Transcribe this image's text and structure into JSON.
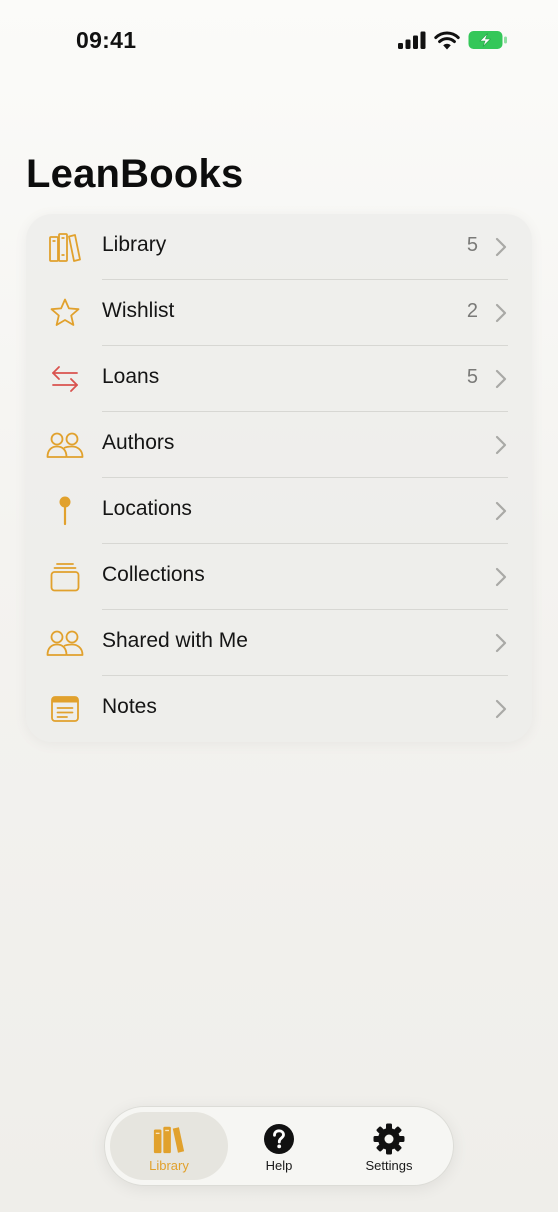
{
  "status_bar": {
    "time": "09:41",
    "icons": [
      "cellular-signal-icon",
      "wifi-icon",
      "battery-charging-icon"
    ]
  },
  "title": "LeanBooks",
  "colors": {
    "accent": "#e1a12d",
    "loans_red": "#d9534f",
    "battery_green": "#34c759",
    "text_primary": "#151515",
    "text_secondary": "#7a7a78"
  },
  "menu": {
    "items": [
      {
        "label": "Library",
        "count": "5",
        "icon": "bookshelf-icon"
      },
      {
        "label": "Wishlist",
        "count": "2",
        "icon": "star-icon"
      },
      {
        "label": "Loans",
        "count": "5",
        "icon": "arrows-exchange-icon"
      },
      {
        "label": "Authors",
        "count": "",
        "icon": "people-icon"
      },
      {
        "label": "Locations",
        "count": "",
        "icon": "pin-icon"
      },
      {
        "label": "Collections",
        "count": "",
        "icon": "stack-icon"
      },
      {
        "label": "Shared with Me",
        "count": "",
        "icon": "people-icon"
      },
      {
        "label": "Notes",
        "count": "",
        "icon": "notes-icon"
      }
    ]
  },
  "tabs": [
    {
      "label": "Library",
      "icon": "books-icon",
      "active": true
    },
    {
      "label": "Help",
      "icon": "question-circle-icon",
      "active": false
    },
    {
      "label": "Settings",
      "icon": "gear-icon",
      "active": false
    }
  ]
}
